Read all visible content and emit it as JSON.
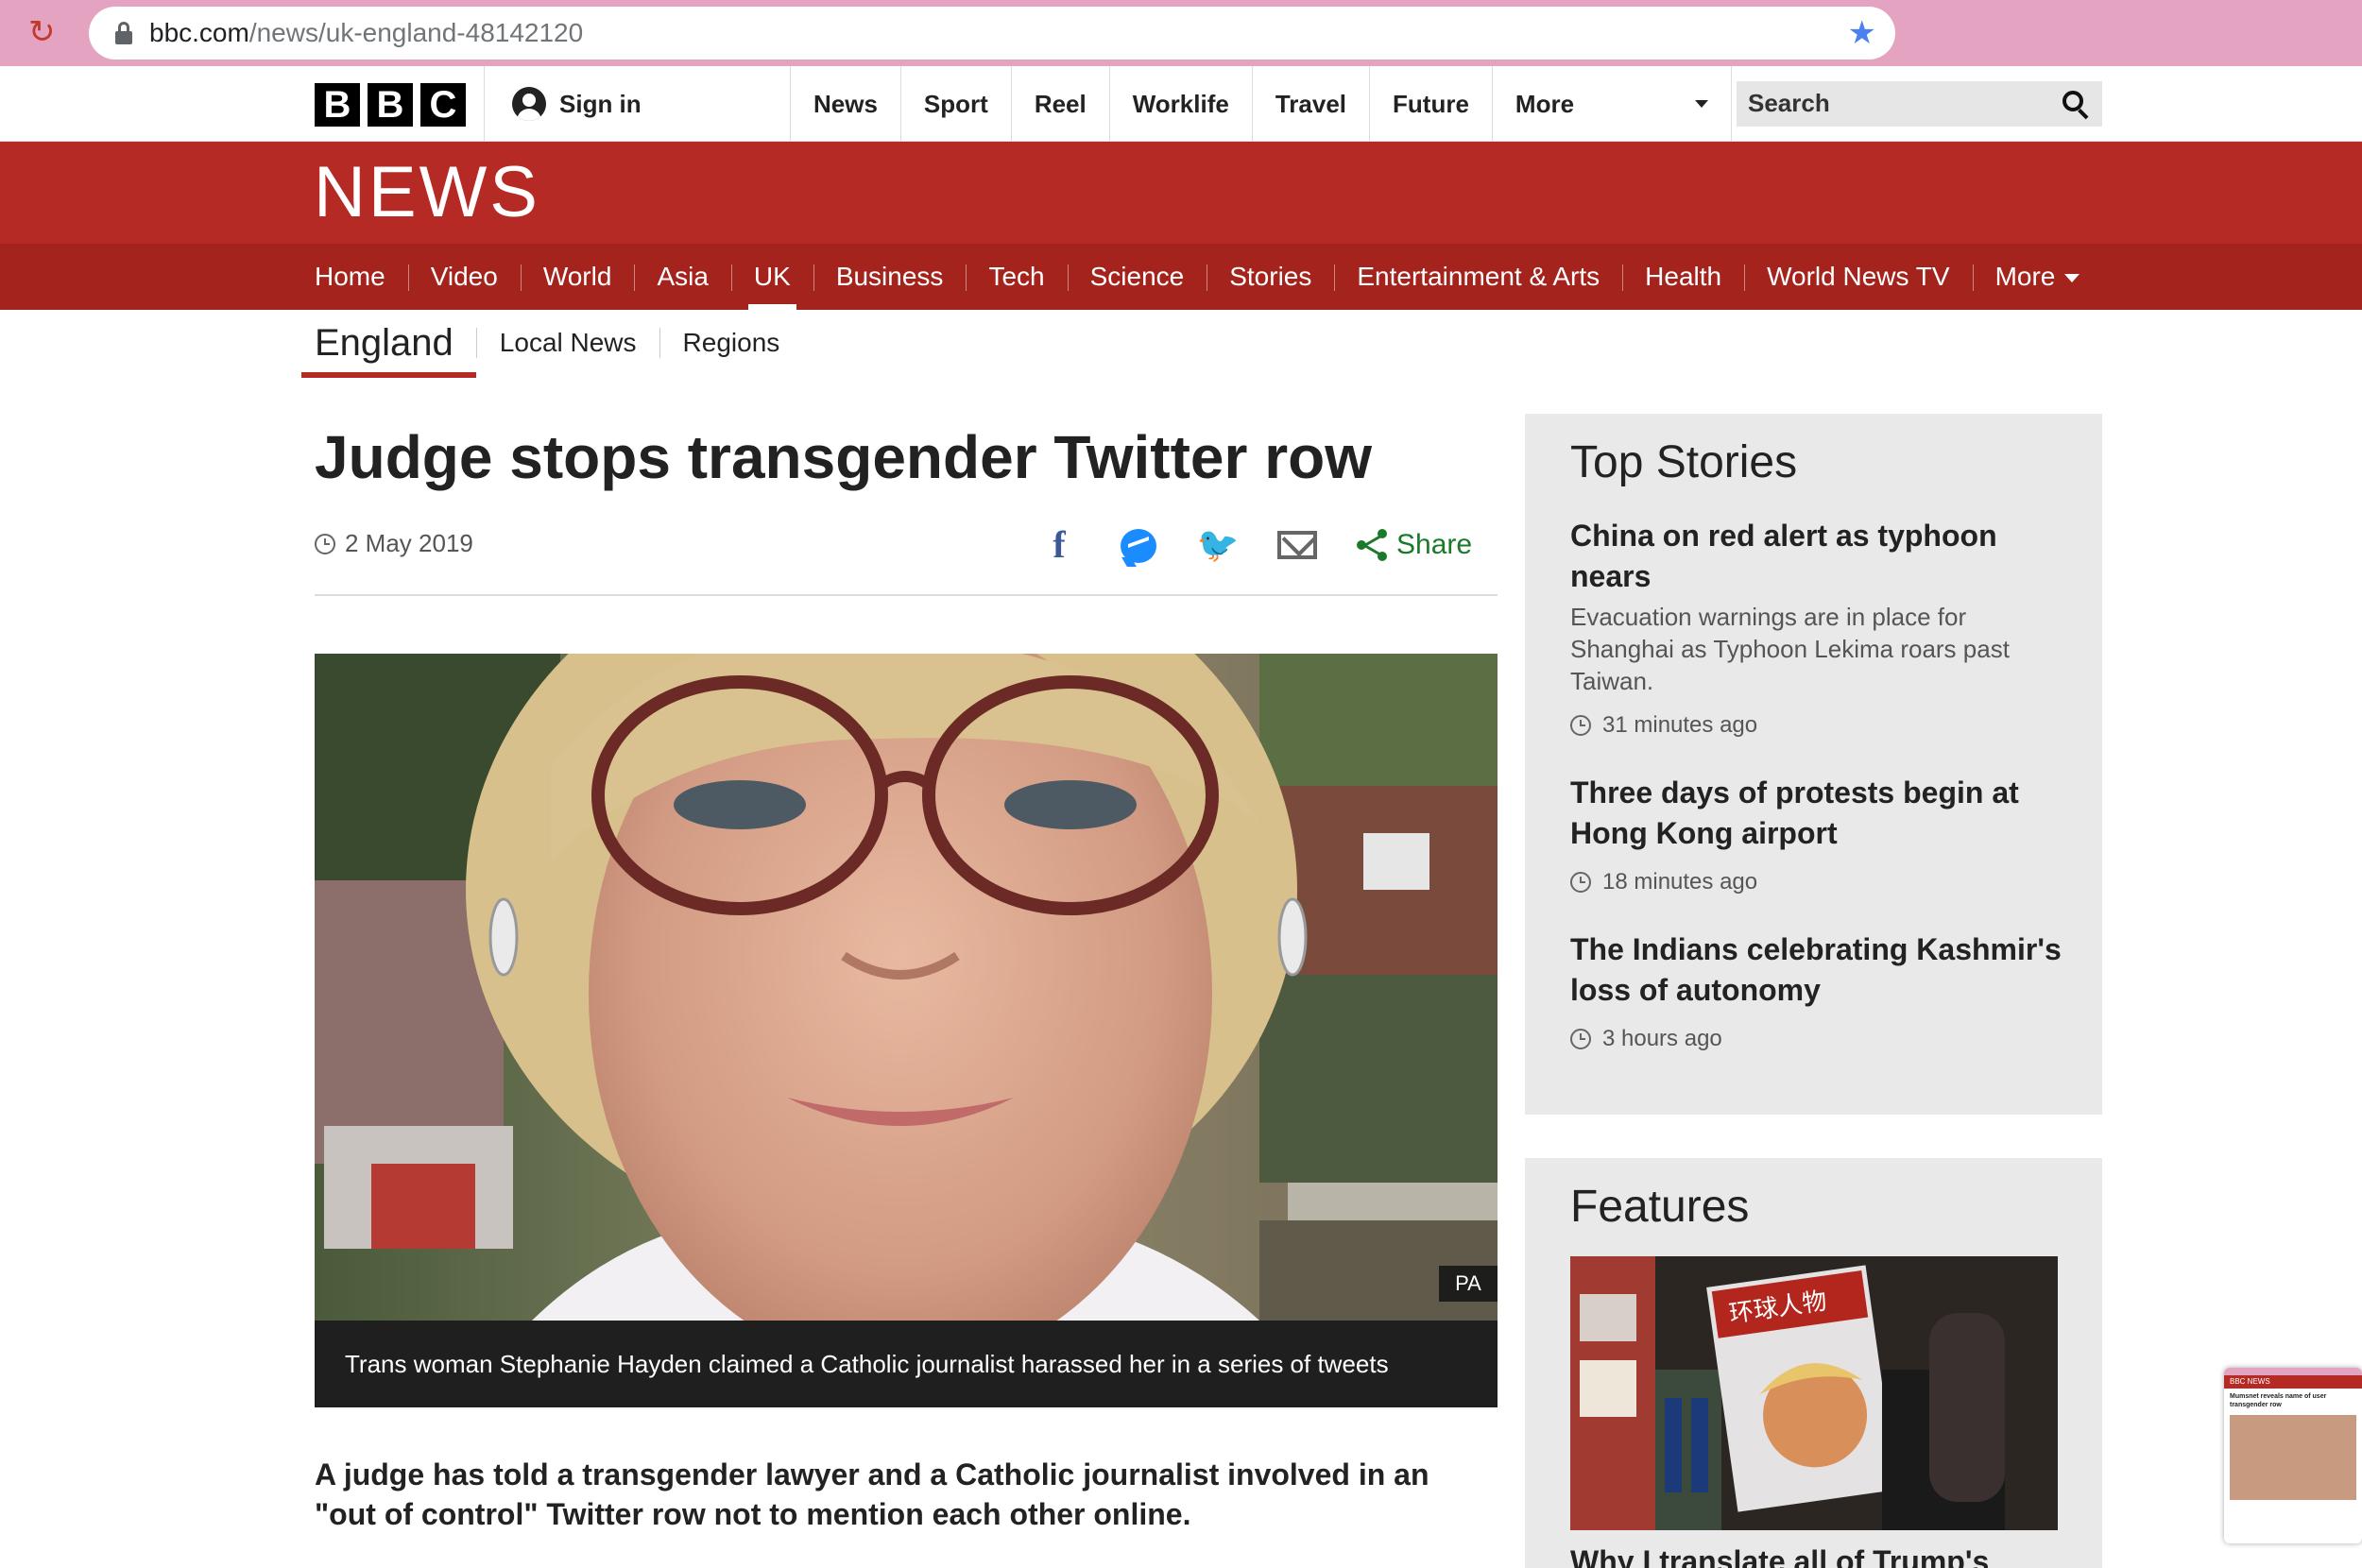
{
  "browser": {
    "url_domain": "bbc.com",
    "url_path": "/news/uk-england-48142120"
  },
  "masthead": {
    "logo_letters": [
      "B",
      "B",
      "C"
    ],
    "sign_in": "Sign in",
    "nav": [
      "News",
      "Sport",
      "Reel",
      "Worklife",
      "Travel",
      "Future",
      "More"
    ],
    "search": "Search"
  },
  "news": {
    "wordmark": "NEWS",
    "sections": [
      "Home",
      "Video",
      "World",
      "Asia",
      "UK",
      "Business",
      "Tech",
      "Science",
      "Stories",
      "Entertainment & Arts",
      "Health",
      "World News TV",
      "More"
    ],
    "active_section": "UK",
    "subnav_home": "England",
    "subnav_items": [
      "Local News",
      "Regions"
    ]
  },
  "article": {
    "headline": "Judge stops transgender Twitter row",
    "date": "2 May 2019",
    "share_label": "Share",
    "image_credit": "PA",
    "image_caption": "Trans woman Stephanie Hayden claimed a Catholic journalist harassed her in a series of tweets",
    "lede": "A judge has told a transgender lawyer and a Catholic journalist involved in an \"out of control\" Twitter row not to mention each other online."
  },
  "top_stories": {
    "heading": "Top Stories",
    "items": [
      {
        "headline": "China on red alert as typhoon nears",
        "summary": "Evacuation warnings are in place for Shanghai as Typhoon Lekima roars past Taiwan.",
        "time": "31 minutes ago"
      },
      {
        "headline": "Three days of protests begin at Hong Kong airport",
        "time": "18 minutes ago"
      },
      {
        "headline": "The Indians celebrating Kashmir's loss of autonomy",
        "time": "3 hours ago"
      }
    ]
  },
  "features": {
    "heading": "Features",
    "first_headline": "Why I translate all of Trump's",
    "image_magazine_text": "环球人物"
  },
  "thumbnail": {
    "text_top": "BBC NEWS",
    "text_body": "Mumsnet reveals name of user transgender row"
  },
  "colors": {
    "bbc_red": "#b52a24",
    "nav_red": "#a4231d",
    "share_green": "#1a7a2a",
    "chrome_pink": "#e4a3c1"
  }
}
